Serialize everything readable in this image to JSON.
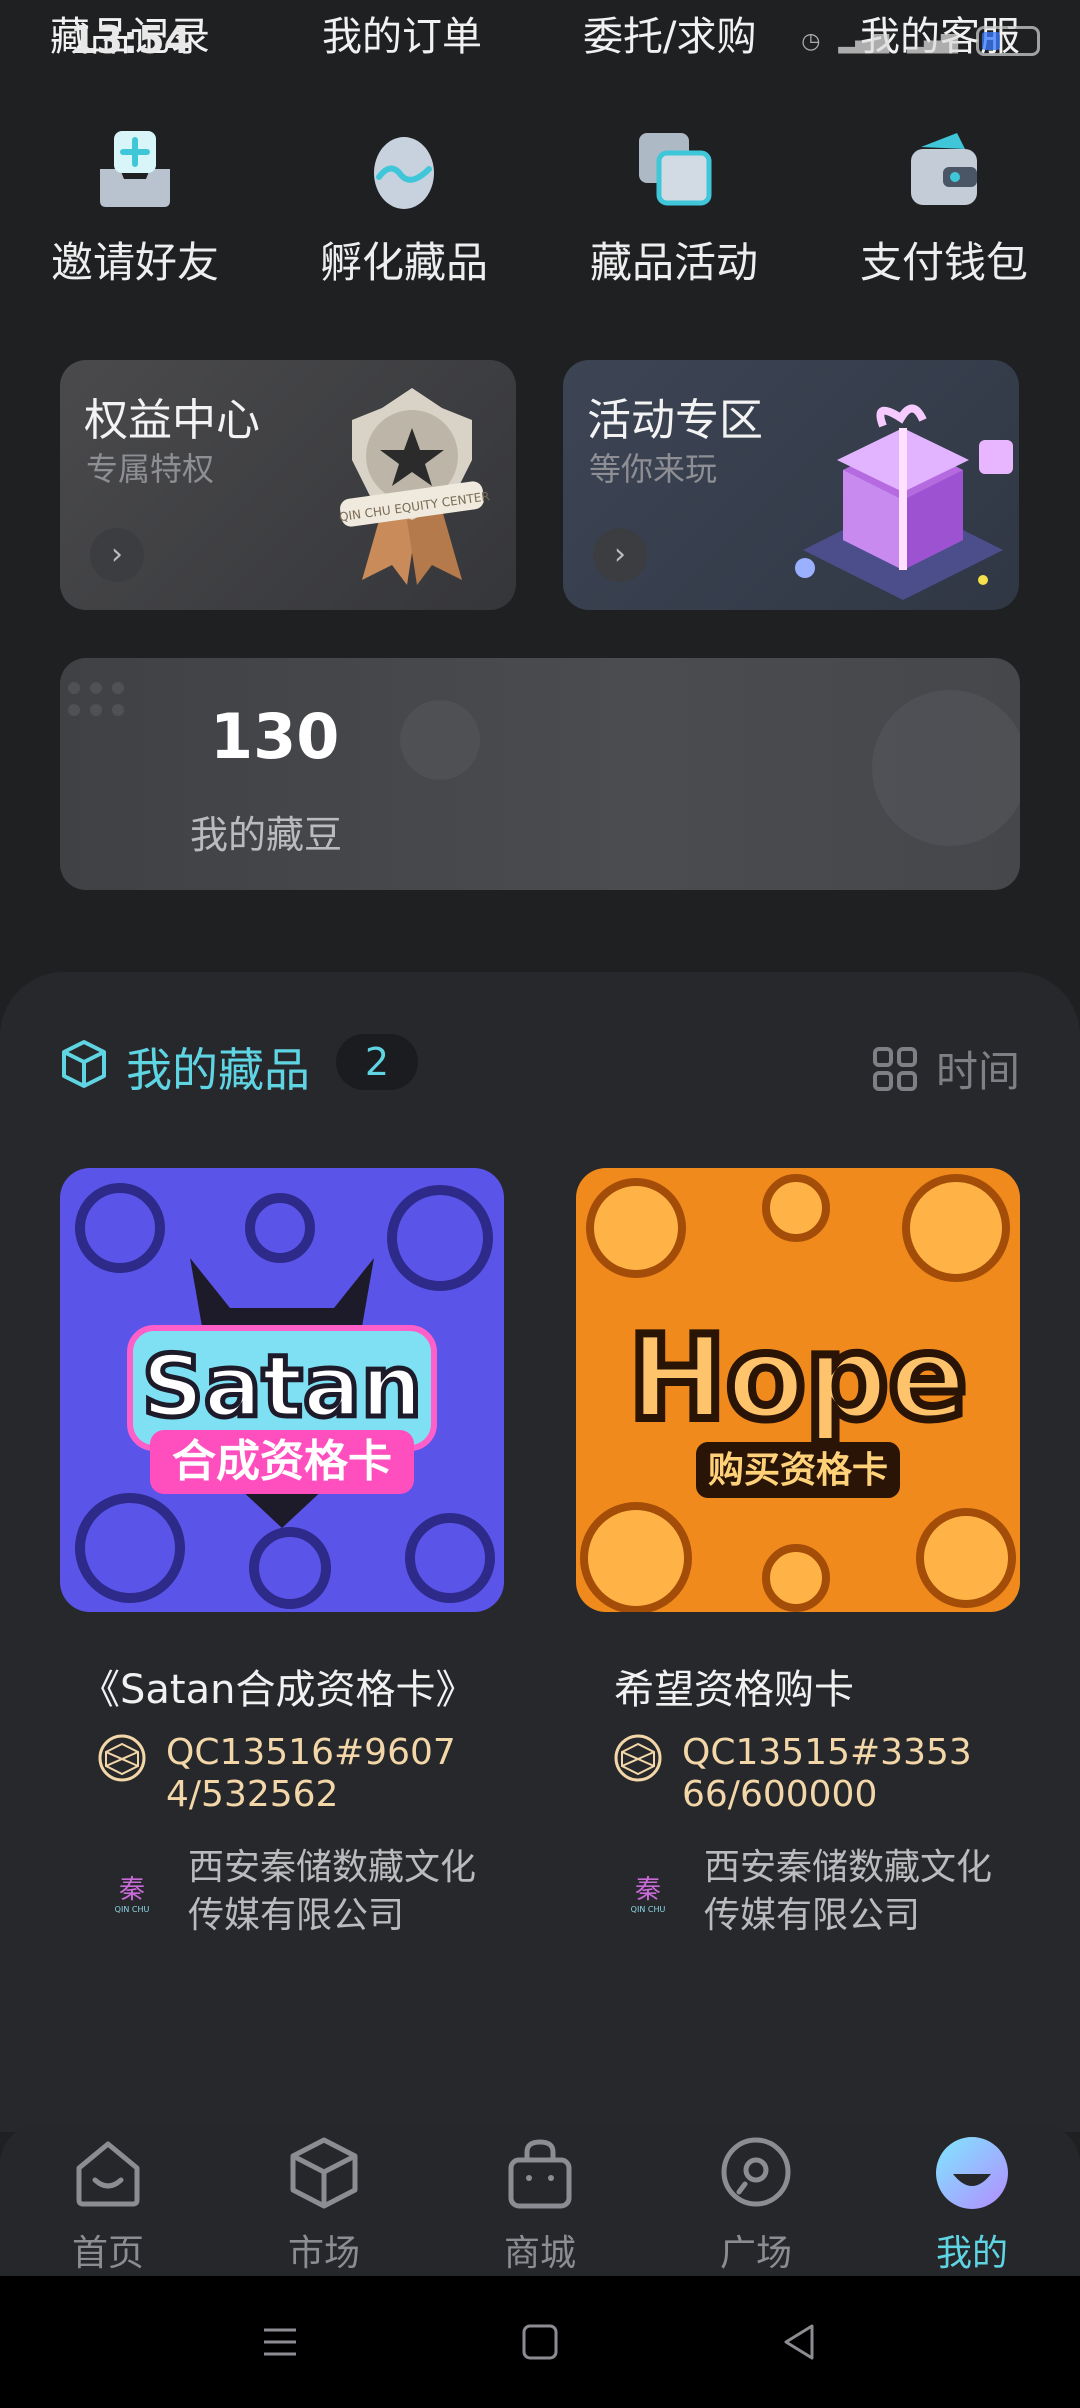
{
  "top_nav": {
    "records": "藏品记录",
    "orders": "我的订单",
    "entrust": "委托/求购",
    "service": "我的客服"
  },
  "status_bar": {
    "time": "13:54"
  },
  "quick_actions": [
    {
      "label": "邀请好友",
      "icon": "invite-icon"
    },
    {
      "label": "孵化藏品",
      "icon": "incubate-icon"
    },
    {
      "label": "藏品活动",
      "icon": "activity-icon"
    },
    {
      "label": "支付钱包",
      "icon": "wallet-icon"
    }
  ],
  "cards": {
    "benefit": {
      "title": "权益中心",
      "subtitle": "专属特权",
      "badge_text": "QIN CHU EQUITY CENTER"
    },
    "activity": {
      "title": "活动专区",
      "subtitle": "等你来玩"
    }
  },
  "beans": {
    "value": "130",
    "label": "我的藏豆"
  },
  "collection": {
    "title": "我的藏品",
    "count": "2",
    "sort_label": "时间",
    "items": [
      {
        "name": "《Satan合成资格卡》",
        "art_word": "Satan",
        "art_sub": "合成资格卡",
        "code": "QC13516#96074/532562",
        "publisher": "西安秦储数藏文化传媒有限公司"
      },
      {
        "name": "希望资格购卡",
        "art_word": "Hope",
        "art_sub": "购买资格卡",
        "code": "QC13515#335366/600000",
        "publisher": "西安秦储数藏文化传媒有限公司"
      }
    ]
  },
  "tabs": [
    {
      "label": "首页",
      "icon": "home-icon"
    },
    {
      "label": "市场",
      "icon": "cube-icon"
    },
    {
      "label": "商城",
      "icon": "bag-icon"
    },
    {
      "label": "广场",
      "icon": "chat-icon"
    },
    {
      "label": "我的",
      "icon": "profile-icon",
      "active": true
    }
  ],
  "colors": {
    "accent": "#5fd4e3",
    "code": "#f3d7a8",
    "background": "#1f2022"
  }
}
